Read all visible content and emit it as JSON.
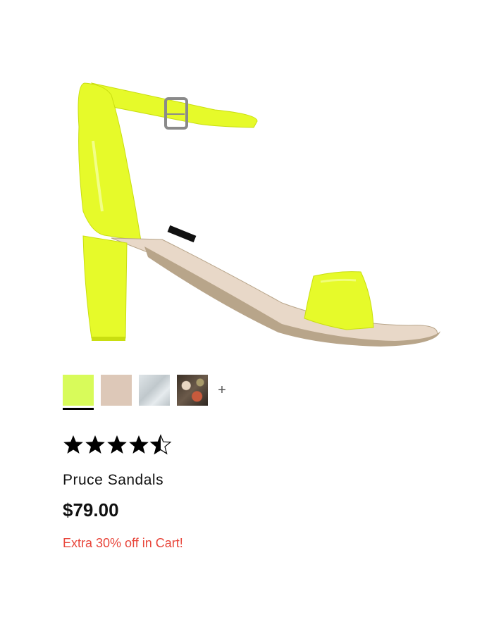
{
  "product": {
    "image_icon": "sandal-product-image",
    "colors": {
      "shoe": "#e6fa2a",
      "shoe_shadow": "#c9de10",
      "footbed": "#e8d8c8",
      "sole": "#b8a58a"
    },
    "swatches": [
      {
        "name": "neon-yellow",
        "color": "#d8fb5a",
        "selected": true
      },
      {
        "name": "nude",
        "color": "#ddc8b8",
        "selected": false
      },
      {
        "name": "silver",
        "color": "#cfd6da",
        "selected": false
      },
      {
        "name": "floral",
        "color": "#6b5a4a",
        "selected": false
      }
    ],
    "more_swatches_label": "+",
    "rating": {
      "value": 4.5,
      "max": 5
    },
    "title": "Pruce Sandals",
    "price": "$79.00",
    "promo": "Extra 30% off in Cart!",
    "promo_color": "#e8453a"
  }
}
